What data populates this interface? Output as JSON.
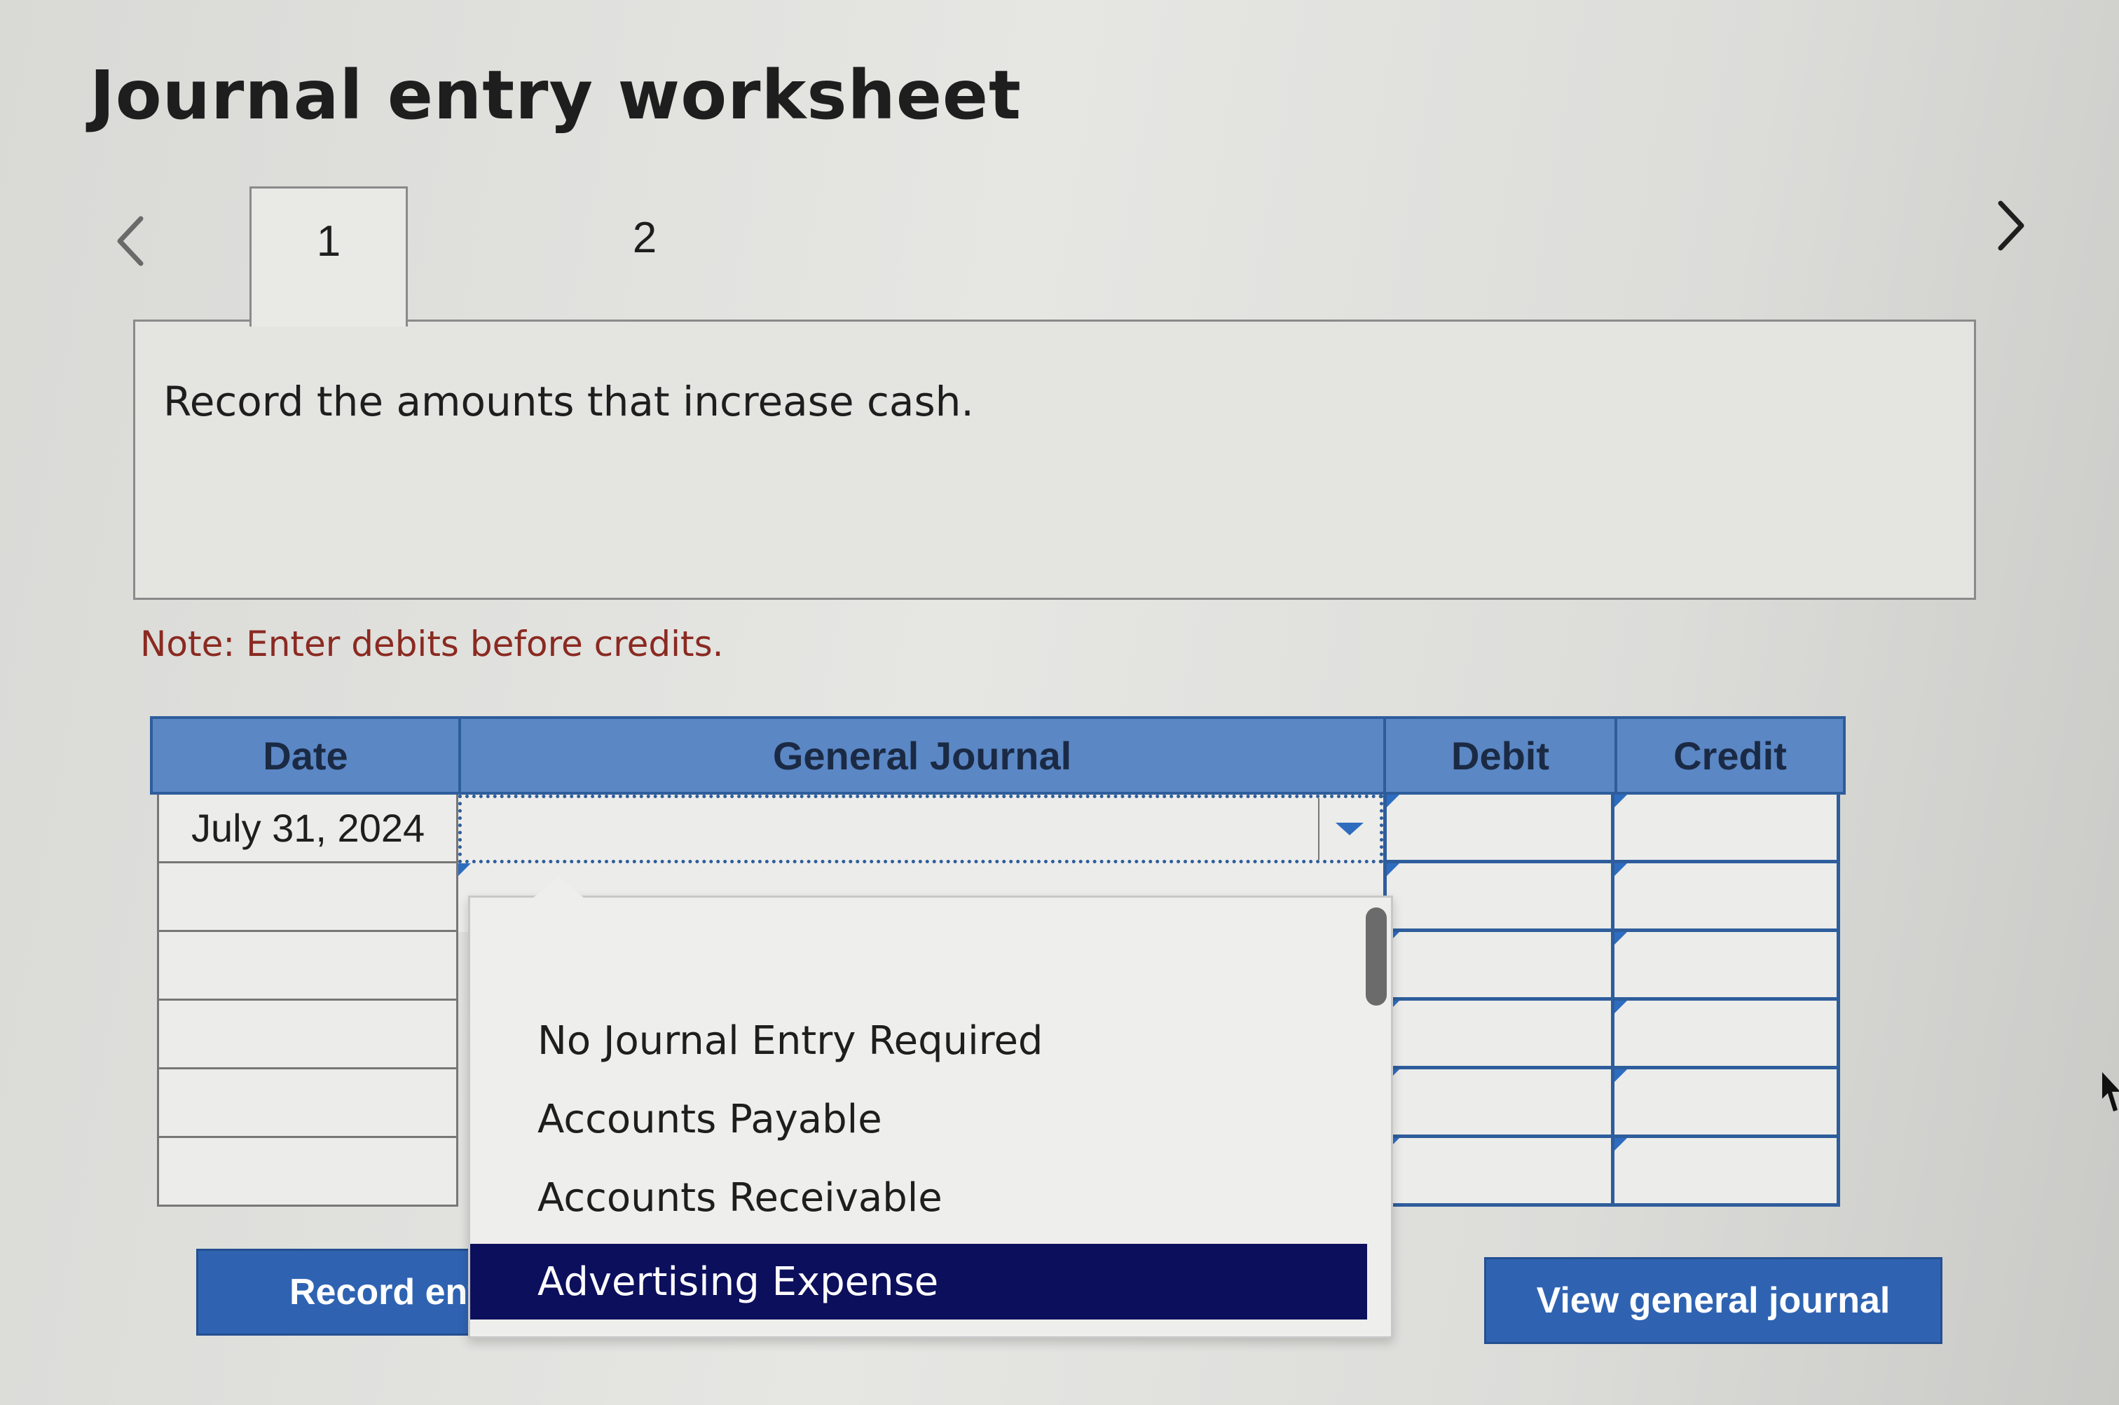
{
  "title": "Journal entry worksheet",
  "tabs": [
    {
      "label": "1",
      "active": true
    },
    {
      "label": "2",
      "active": false
    }
  ],
  "instruction": "Record the amounts that increase cash.",
  "note": "Note: Enter debits before credits.",
  "table": {
    "headers": {
      "date": "Date",
      "general_journal": "General Journal",
      "debit": "Debit",
      "credit": "Credit"
    },
    "rows": [
      {
        "date": "July 31, 2024",
        "account": "",
        "debit": "",
        "credit": ""
      },
      {
        "date": "",
        "account": "",
        "debit": "",
        "credit": ""
      },
      {
        "date": "",
        "account": "",
        "debit": "",
        "credit": ""
      },
      {
        "date": "",
        "account": "",
        "debit": "",
        "credit": ""
      },
      {
        "date": "",
        "account": "",
        "debit": "",
        "credit": ""
      },
      {
        "date": "",
        "account": "",
        "debit": "",
        "credit": ""
      }
    ]
  },
  "dropdown": {
    "options": [
      "No Journal Entry Required",
      "Accounts Payable",
      "Accounts Receivable",
      "Advertising Expense"
    ],
    "highlighted": "Advertising Expense"
  },
  "buttons": {
    "record_entry": "Record entry",
    "view_general_journal": "View general journal"
  },
  "icons": {
    "prev": "chevron-left-icon",
    "next": "chevron-right-icon",
    "dropdown": "caret-down-icon"
  },
  "colors": {
    "header_blue": "#5b87c5",
    "button_blue": "#2f63b2",
    "selected_navy": "#0c0f5c",
    "note_red": "#8a2a21"
  }
}
